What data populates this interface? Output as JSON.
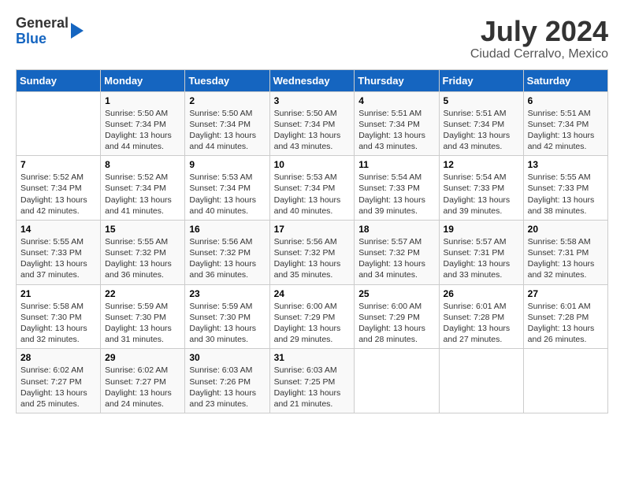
{
  "logo": {
    "general": "General",
    "blue": "Blue"
  },
  "title": "July 2024",
  "location": "Ciudad Cerralvo, Mexico",
  "days_header": [
    "Sunday",
    "Monday",
    "Tuesday",
    "Wednesday",
    "Thursday",
    "Friday",
    "Saturday"
  ],
  "weeks": [
    [
      {
        "day": "",
        "sunrise": "",
        "sunset": "",
        "daylight": ""
      },
      {
        "day": "1",
        "sunrise": "Sunrise: 5:50 AM",
        "sunset": "Sunset: 7:34 PM",
        "daylight": "Daylight: 13 hours and 44 minutes."
      },
      {
        "day": "2",
        "sunrise": "Sunrise: 5:50 AM",
        "sunset": "Sunset: 7:34 PM",
        "daylight": "Daylight: 13 hours and 44 minutes."
      },
      {
        "day": "3",
        "sunrise": "Sunrise: 5:50 AM",
        "sunset": "Sunset: 7:34 PM",
        "daylight": "Daylight: 13 hours and 43 minutes."
      },
      {
        "day": "4",
        "sunrise": "Sunrise: 5:51 AM",
        "sunset": "Sunset: 7:34 PM",
        "daylight": "Daylight: 13 hours and 43 minutes."
      },
      {
        "day": "5",
        "sunrise": "Sunrise: 5:51 AM",
        "sunset": "Sunset: 7:34 PM",
        "daylight": "Daylight: 13 hours and 43 minutes."
      },
      {
        "day": "6",
        "sunrise": "Sunrise: 5:51 AM",
        "sunset": "Sunset: 7:34 PM",
        "daylight": "Daylight: 13 hours and 42 minutes."
      }
    ],
    [
      {
        "day": "7",
        "sunrise": "Sunrise: 5:52 AM",
        "sunset": "Sunset: 7:34 PM",
        "daylight": "Daylight: 13 hours and 42 minutes."
      },
      {
        "day": "8",
        "sunrise": "Sunrise: 5:52 AM",
        "sunset": "Sunset: 7:34 PM",
        "daylight": "Daylight: 13 hours and 41 minutes."
      },
      {
        "day": "9",
        "sunrise": "Sunrise: 5:53 AM",
        "sunset": "Sunset: 7:34 PM",
        "daylight": "Daylight: 13 hours and 40 minutes."
      },
      {
        "day": "10",
        "sunrise": "Sunrise: 5:53 AM",
        "sunset": "Sunset: 7:34 PM",
        "daylight": "Daylight: 13 hours and 40 minutes."
      },
      {
        "day": "11",
        "sunrise": "Sunrise: 5:54 AM",
        "sunset": "Sunset: 7:33 PM",
        "daylight": "Daylight: 13 hours and 39 minutes."
      },
      {
        "day": "12",
        "sunrise": "Sunrise: 5:54 AM",
        "sunset": "Sunset: 7:33 PM",
        "daylight": "Daylight: 13 hours and 39 minutes."
      },
      {
        "day": "13",
        "sunrise": "Sunrise: 5:55 AM",
        "sunset": "Sunset: 7:33 PM",
        "daylight": "Daylight: 13 hours and 38 minutes."
      }
    ],
    [
      {
        "day": "14",
        "sunrise": "Sunrise: 5:55 AM",
        "sunset": "Sunset: 7:33 PM",
        "daylight": "Daylight: 13 hours and 37 minutes."
      },
      {
        "day": "15",
        "sunrise": "Sunrise: 5:55 AM",
        "sunset": "Sunset: 7:32 PM",
        "daylight": "Daylight: 13 hours and 36 minutes."
      },
      {
        "day": "16",
        "sunrise": "Sunrise: 5:56 AM",
        "sunset": "Sunset: 7:32 PM",
        "daylight": "Daylight: 13 hours and 36 minutes."
      },
      {
        "day": "17",
        "sunrise": "Sunrise: 5:56 AM",
        "sunset": "Sunset: 7:32 PM",
        "daylight": "Daylight: 13 hours and 35 minutes."
      },
      {
        "day": "18",
        "sunrise": "Sunrise: 5:57 AM",
        "sunset": "Sunset: 7:32 PM",
        "daylight": "Daylight: 13 hours and 34 minutes."
      },
      {
        "day": "19",
        "sunrise": "Sunrise: 5:57 AM",
        "sunset": "Sunset: 7:31 PM",
        "daylight": "Daylight: 13 hours and 33 minutes."
      },
      {
        "day": "20",
        "sunrise": "Sunrise: 5:58 AM",
        "sunset": "Sunset: 7:31 PM",
        "daylight": "Daylight: 13 hours and 32 minutes."
      }
    ],
    [
      {
        "day": "21",
        "sunrise": "Sunrise: 5:58 AM",
        "sunset": "Sunset: 7:30 PM",
        "daylight": "Daylight: 13 hours and 32 minutes."
      },
      {
        "day": "22",
        "sunrise": "Sunrise: 5:59 AM",
        "sunset": "Sunset: 7:30 PM",
        "daylight": "Daylight: 13 hours and 31 minutes."
      },
      {
        "day": "23",
        "sunrise": "Sunrise: 5:59 AM",
        "sunset": "Sunset: 7:30 PM",
        "daylight": "Daylight: 13 hours and 30 minutes."
      },
      {
        "day": "24",
        "sunrise": "Sunrise: 6:00 AM",
        "sunset": "Sunset: 7:29 PM",
        "daylight": "Daylight: 13 hours and 29 minutes."
      },
      {
        "day": "25",
        "sunrise": "Sunrise: 6:00 AM",
        "sunset": "Sunset: 7:29 PM",
        "daylight": "Daylight: 13 hours and 28 minutes."
      },
      {
        "day": "26",
        "sunrise": "Sunrise: 6:01 AM",
        "sunset": "Sunset: 7:28 PM",
        "daylight": "Daylight: 13 hours and 27 minutes."
      },
      {
        "day": "27",
        "sunrise": "Sunrise: 6:01 AM",
        "sunset": "Sunset: 7:28 PM",
        "daylight": "Daylight: 13 hours and 26 minutes."
      }
    ],
    [
      {
        "day": "28",
        "sunrise": "Sunrise: 6:02 AM",
        "sunset": "Sunset: 7:27 PM",
        "daylight": "Daylight: 13 hours and 25 minutes."
      },
      {
        "day": "29",
        "sunrise": "Sunrise: 6:02 AM",
        "sunset": "Sunset: 7:27 PM",
        "daylight": "Daylight: 13 hours and 24 minutes."
      },
      {
        "day": "30",
        "sunrise": "Sunrise: 6:03 AM",
        "sunset": "Sunset: 7:26 PM",
        "daylight": "Daylight: 13 hours and 23 minutes."
      },
      {
        "day": "31",
        "sunrise": "Sunrise: 6:03 AM",
        "sunset": "Sunset: 7:25 PM",
        "daylight": "Daylight: 13 hours and 21 minutes."
      },
      {
        "day": "",
        "sunrise": "",
        "sunset": "",
        "daylight": ""
      },
      {
        "day": "",
        "sunrise": "",
        "sunset": "",
        "daylight": ""
      },
      {
        "day": "",
        "sunrise": "",
        "sunset": "",
        "daylight": ""
      }
    ]
  ]
}
